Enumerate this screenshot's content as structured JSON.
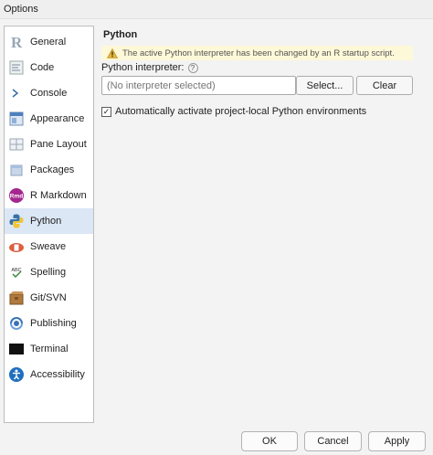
{
  "window": {
    "title": "Options"
  },
  "sidebar": {
    "items": [
      {
        "label": "General",
        "icon": "r-logo-icon"
      },
      {
        "label": "Code",
        "icon": "code-icon"
      },
      {
        "label": "Console",
        "icon": "console-icon"
      },
      {
        "label": "Appearance",
        "icon": "appearance-icon"
      },
      {
        "label": "Pane Layout",
        "icon": "pane-layout-icon"
      },
      {
        "label": "Packages",
        "icon": "packages-icon"
      },
      {
        "label": "R Markdown",
        "icon": "rmarkdown-icon"
      },
      {
        "label": "Python",
        "icon": "python-icon",
        "selected": true
      },
      {
        "label": "Sweave",
        "icon": "sweave-icon"
      },
      {
        "label": "Spelling",
        "icon": "spelling-icon"
      },
      {
        "label": "Git/SVN",
        "icon": "git-svn-icon"
      },
      {
        "label": "Publishing",
        "icon": "publishing-icon"
      },
      {
        "label": "Terminal",
        "icon": "terminal-icon"
      },
      {
        "label": "Accessibility",
        "icon": "accessibility-icon"
      }
    ],
    "rmd_badge": "Rmd",
    "abc_badge": "ABC"
  },
  "python": {
    "title": "Python",
    "warning": "The active Python interpreter has been changed by an R startup script.",
    "interpreter_label": "Python interpreter:",
    "help_glyph": "?",
    "interpreter_placeholder": "(No interpreter selected)",
    "select_button": "Select...",
    "clear_button": "Clear",
    "auto_activate_label": "Automatically activate project-local Python environments",
    "auto_activate_checked": true,
    "check_glyph": "✓"
  },
  "footer": {
    "ok": "OK",
    "cancel": "Cancel",
    "apply": "Apply"
  },
  "colors": {
    "selected_bg": "#dbe7f5",
    "warning_bg": "#fdf8d8",
    "warning_icon": "#e3b53a"
  }
}
